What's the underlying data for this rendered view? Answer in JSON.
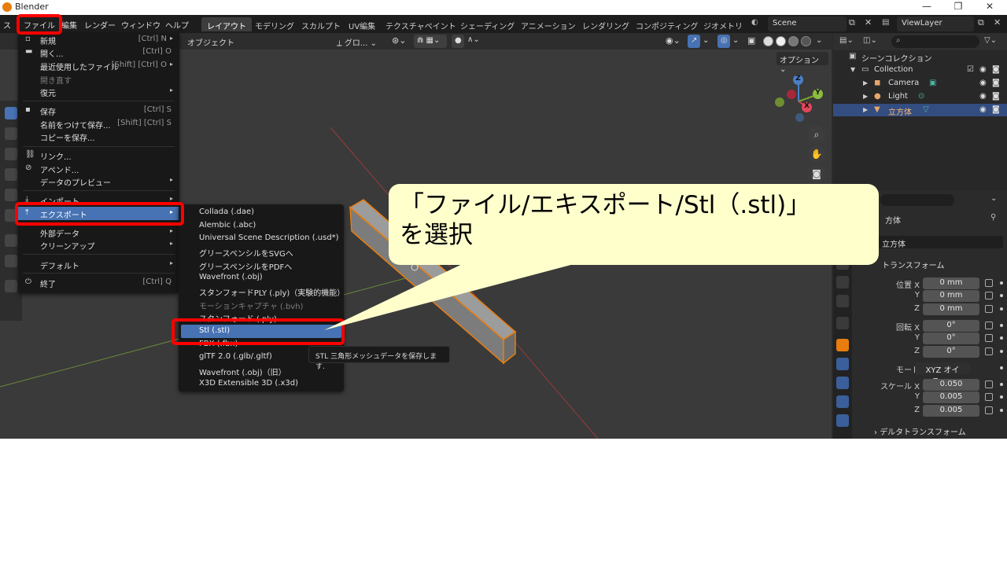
{
  "window": {
    "title": "Blender"
  },
  "menubar": {
    "items": [
      "ファイル",
      "編集",
      "レンダー",
      "ウィンドウ",
      "ヘルプ"
    ],
    "workspaces": [
      "レイアウト",
      "モデリング",
      "スカルプト",
      "UV編集",
      "テクスチャペイント",
      "シェーディング",
      "アニメーション",
      "レンダリング",
      "コンポジティング",
      "ジオメトリ"
    ],
    "scene": "Scene",
    "view_layer": "ViewLayer"
  },
  "viewport": {
    "mode": "オブジェクト",
    "transform_orientation": "グロ...",
    "options": "オプション"
  },
  "file_menu": {
    "items": [
      {
        "label": "新規",
        "shortcut": "[Ctrl] N",
        "arrow": "▸"
      },
      {
        "label": "開く...",
        "shortcut": "[Ctrl] O",
        "arrow": ""
      },
      {
        "label": "最近使用したファイル",
        "shortcut": "[Shift] [Ctrl] O",
        "arrow": "▸"
      },
      {
        "label": "開き直す",
        "shortcut": "",
        "arrow": ""
      },
      {
        "label": "復元",
        "shortcut": "",
        "arrow": "▸"
      },
      {
        "label": "保存",
        "shortcut": "[Ctrl] S",
        "arrow": ""
      },
      {
        "label": "名前をつけて保存...",
        "shortcut": "[Shift] [Ctrl] S",
        "arrow": ""
      },
      {
        "label": "コピーを保存...",
        "shortcut": "",
        "arrow": ""
      },
      {
        "label": "リンク...",
        "shortcut": "",
        "arrow": ""
      },
      {
        "label": "アペンド...",
        "shortcut": "",
        "arrow": ""
      },
      {
        "label": "データのプレビュー",
        "shortcut": "",
        "arrow": "▸"
      },
      {
        "label": "インポート",
        "shortcut": "",
        "arrow": "▸"
      },
      {
        "label": "エクスポート",
        "shortcut": "",
        "arrow": "▸"
      },
      {
        "label": "外部データ",
        "shortcut": "",
        "arrow": "▸"
      },
      {
        "label": "クリーンアップ",
        "shortcut": "",
        "arrow": "▸"
      },
      {
        "label": "デフォルト",
        "shortcut": "",
        "arrow": "▸"
      },
      {
        "label": "終了",
        "shortcut": "[Ctrl] Q",
        "arrow": ""
      }
    ]
  },
  "export_menu": {
    "items": [
      "Collada (.dae)",
      "Alembic (.abc)",
      "Universal Scene Description (.usd*)",
      "グリースペンシルをSVGへ",
      "グリースペンシルをPDFへ",
      "Wavefront (.obj)",
      "スタンフォードPLY (.ply)（実験的機能）",
      "モーションキャプチャ (.bvh)",
      "スタンフォード (.ply)",
      "Stl (.stl)",
      "FBX (.fbx)",
      "glTF 2.0 (.glb/.gltf)",
      "Wavefront (.obj)（旧）",
      "X3D Extensible 3D (.x3d)"
    ],
    "tooltip": "STL 三角形メッシュデータを保存します."
  },
  "callout": {
    "line1": "「ファイル/エキスポート/Stl（.stl)」",
    "line2": "を選択"
  },
  "outliner": {
    "root": "シーンコレクション",
    "collection": "Collection",
    "objects": [
      "Camera",
      "Light",
      "立方体"
    ]
  },
  "properties": {
    "object_name_short": "方体",
    "object_name": "立方体",
    "section_transform": "トランスフォーム",
    "location_label": "位置 X",
    "location": [
      "0 mm",
      "0 mm",
      "0 mm"
    ],
    "rotation_label": "回転 X",
    "rotation": [
      "0°",
      "0°",
      "0°"
    ],
    "mode_label": "モード",
    "mode": "XYZ オイラ...",
    "scale_label": "スケール X",
    "scale": [
      "0.050",
      "0.005",
      "0.005"
    ],
    "axis_y": "Y",
    "axis_z": "Z",
    "delta": "デルタトランスフォーム"
  },
  "colors": {
    "accent": "#4772b3",
    "highlight": "#ff0000",
    "callout_bg": "#ffffcc",
    "selection_outline": "#e87d0d"
  }
}
